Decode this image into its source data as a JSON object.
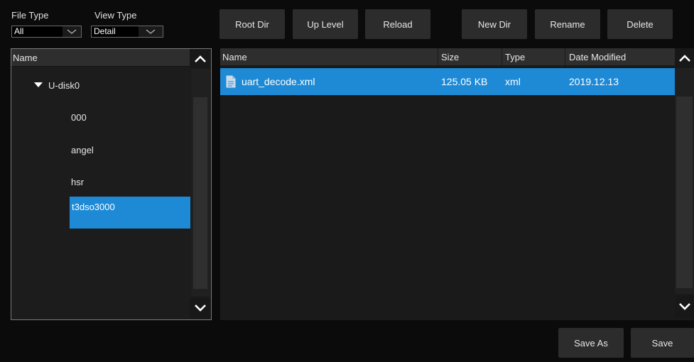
{
  "filters": {
    "file_type": {
      "label": "File Type",
      "value": "All"
    },
    "view_type": {
      "label": "View Type",
      "value": "Detail"
    }
  },
  "toolbar": {
    "root_dir": "Root Dir",
    "up_level": "Up Level",
    "reload": "Reload",
    "new_dir": "New Dir",
    "rename": "Rename",
    "delete": "Delete"
  },
  "tree": {
    "header": "Name",
    "items": [
      {
        "label": "U-disk0",
        "expanded": true
      },
      {
        "label": "000"
      },
      {
        "label": "angel"
      },
      {
        "label": "hsr"
      },
      {
        "label": "t3dso3000",
        "selected": true
      }
    ]
  },
  "file_list": {
    "columns": [
      "Name",
      "Size",
      "Type",
      "Date Modified"
    ],
    "rows": [
      {
        "name": "uart_decode.xml",
        "size": "125.05 KB",
        "type": "xml",
        "date": "2019.12.13",
        "icon": "document-icon",
        "selected": true
      }
    ]
  },
  "footer": {
    "save_as": "Save As",
    "save": "Save"
  },
  "colors": {
    "accent": "#1e8ad6",
    "background": "#0b0b0b",
    "button": "#2c2c2c"
  }
}
